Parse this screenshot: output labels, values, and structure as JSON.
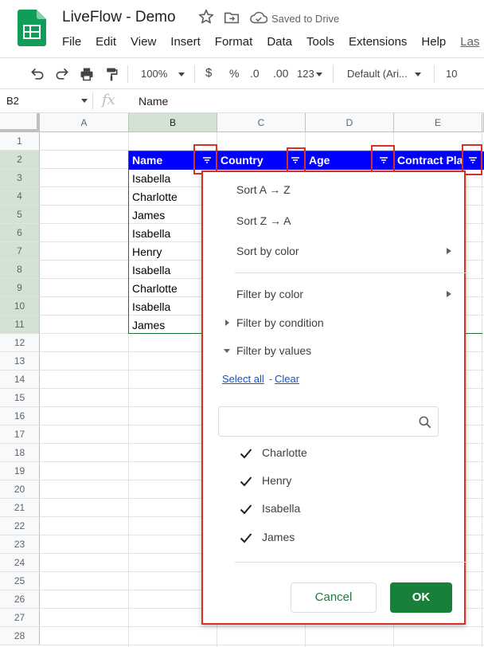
{
  "app": {
    "title": "LiveFlow - Demo",
    "save_status": "Saved to Drive",
    "menus": [
      "File",
      "Edit",
      "View",
      "Insert",
      "Format",
      "Data",
      "Tools",
      "Extensions",
      "Help"
    ],
    "last_edit": "Las",
    "brand_color": "#0f9d58"
  },
  "toolbar": {
    "zoom": "100%",
    "currency": "$",
    "percent": "%",
    "decrease_decimals": ".0",
    "increase_decimals": ".00",
    "number_format": "123",
    "font": "Default (Ari...",
    "font_size": "10"
  },
  "formula_bar": {
    "cell_ref": "B2",
    "fx_label": "fx",
    "content": "Name"
  },
  "grid": {
    "columns": [
      "A",
      "B",
      "C",
      "D",
      "E"
    ],
    "rows": [
      "1",
      "2",
      "3",
      "4",
      "5",
      "6",
      "7",
      "8",
      "9",
      "10",
      "11",
      "12",
      "13",
      "14",
      "15",
      "16",
      "17",
      "18",
      "19",
      "20",
      "21",
      "22",
      "23",
      "24",
      "25",
      "26",
      "27",
      "28"
    ],
    "selected_column": "B",
    "header_fill": "#0000ff"
  },
  "table": {
    "headers": [
      "Name",
      "Country",
      "Age",
      "Contract Pla"
    ],
    "names": [
      "Isabella",
      "Charlotte",
      "James",
      "Isabella",
      "Henry",
      "Isabella",
      "Charlotte",
      "Isabella",
      "James"
    ]
  },
  "filter_menu": {
    "sort_az": "Sort A → Z",
    "sort_za": "Sort Z → A",
    "sort_by_color": "Sort by color",
    "filter_by_color": "Filter by color",
    "filter_by_condition": "Filter by condition",
    "filter_by_values": "Filter by values",
    "select_all": "Select all",
    "separator": "-",
    "clear": "Clear",
    "search_placeholder": "",
    "values": [
      "Charlotte",
      "Henry",
      "Isabella",
      "James"
    ],
    "cancel": "Cancel",
    "ok": "OK"
  },
  "colors": {
    "highlight": "#d93025",
    "ok_button": "#188038",
    "link": "#1155cc"
  }
}
